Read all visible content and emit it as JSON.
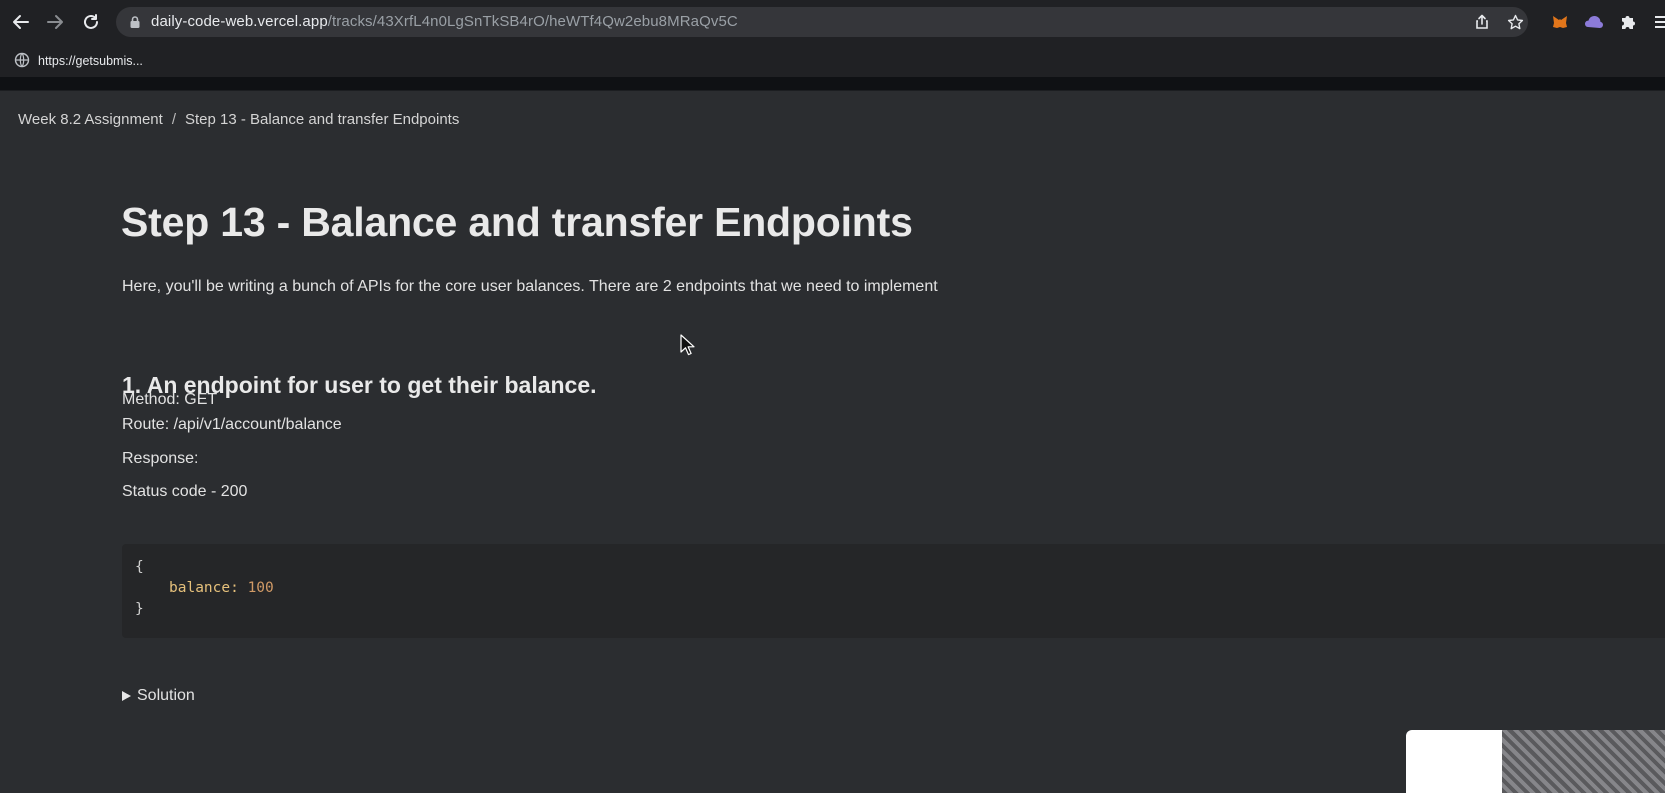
{
  "browser": {
    "url_host": "daily-code-web.vercel.app",
    "url_path": "/tracks/43XrfL4n0LgSnTkSB4rO/heWTf4Qw2ebu8MRaQv5C",
    "bookmark_label": "https://getsubmis..."
  },
  "page": {
    "breadcrumb": {
      "parent": "Week 8.2 Assignment",
      "separator": "/",
      "current": "Step 13 - Balance and transfer Endpoints"
    },
    "title": "Step 13 - Balance and transfer Endpoints",
    "intro": "Here, you'll be writing a bunch of APIs for the core user balances. There are 2 endpoints that we need to implement",
    "section1": {
      "heading": "1. An endpoint for user to get their balance.",
      "method": "Method: GET",
      "route": "Route: /api/v1/account/balance",
      "response": "Response:",
      "status": "Status code - 200",
      "code": {
        "open": "{",
        "key": "balance:",
        "value": "100",
        "close": "}"
      }
    },
    "solution_label": "Solution"
  },
  "icons": [
    "back-icon",
    "forward-icon",
    "reload-icon",
    "lock-icon",
    "share-icon",
    "star-icon",
    "metamask-icon",
    "extension-cloud-icon",
    "puzzle-icon",
    "menu-icon",
    "globe-icon",
    "cursor-icon"
  ]
}
